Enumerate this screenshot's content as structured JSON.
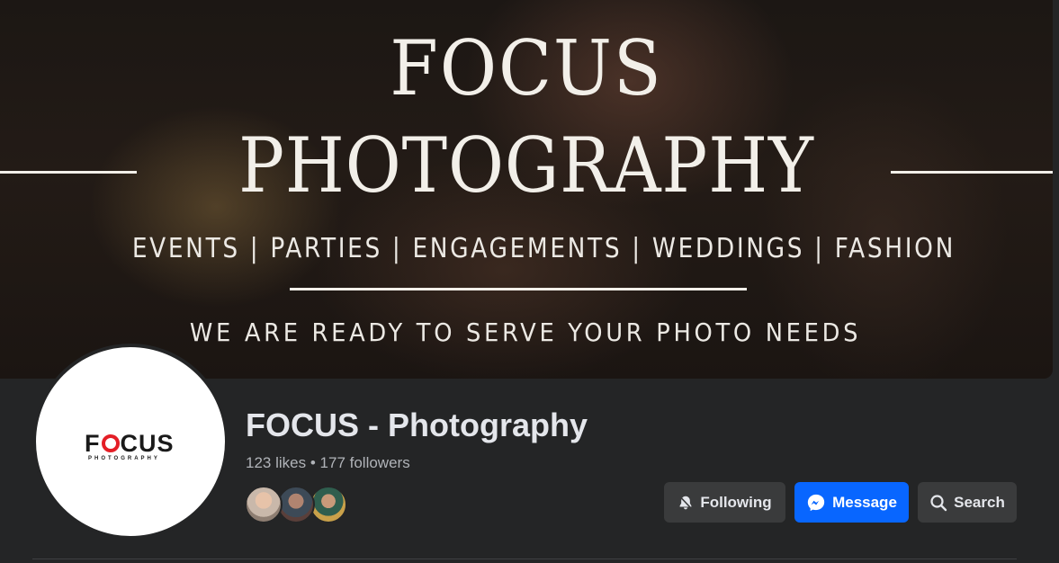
{
  "cover": {
    "title_line1": "FOCUS",
    "title_line2": "PHOTOGRAPHY",
    "services": "EVENTS | PARTIES | ENGAGEMENTS | WEDDINGS | FASHION",
    "tagline": "WE ARE READY TO SERVE YOUR PHOTO NEEDS"
  },
  "avatar": {
    "logo_word_left": "F",
    "logo_word_right": "CUS",
    "logo_sub": "PHOTOGRAPHY",
    "accent_color": "#e41e26"
  },
  "profile": {
    "name": "FOCUS - Photography",
    "likes": "123 likes",
    "separator": "•",
    "followers": "177 followers",
    "friend_avatars": [
      "friend-1",
      "friend-2",
      "friend-3"
    ]
  },
  "actions": {
    "following_label": "Following",
    "following_icon": "bell-icon",
    "message_label": "Message",
    "message_icon": "messenger-icon",
    "search_label": "Search",
    "search_icon": "search-icon"
  },
  "colors": {
    "background": "#242526",
    "primary_button": "#0866ff",
    "secondary_button": "#3a3b3c",
    "text_primary": "#e4e6eb",
    "text_secondary": "#b0b3b8"
  }
}
